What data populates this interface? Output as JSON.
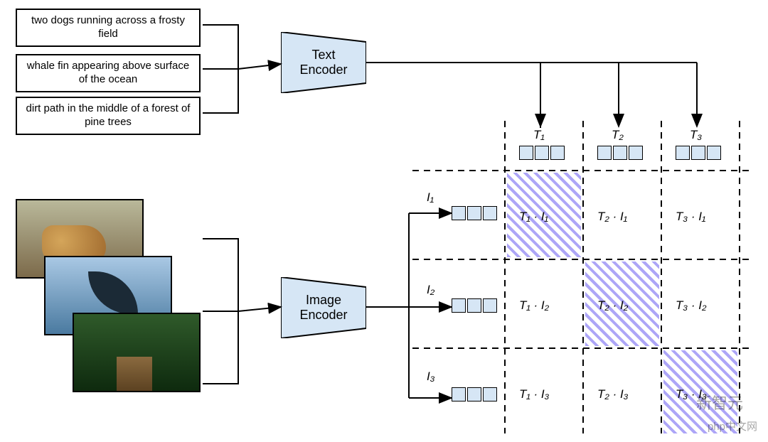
{
  "texts": {
    "t1": "two dogs running across a frosty field",
    "t2": "whale fin appearing above surface of the ocean",
    "t3": "dirt path in the middle of a forest of pine trees"
  },
  "encoders": {
    "text": "Text\nEncoder",
    "image": "Image\nEncoder"
  },
  "images": {
    "i1_desc": "two golden dogs running in a field",
    "i2_desc": "whale fin above ocean surface",
    "i3_desc": "dirt path through a pine forest"
  },
  "matrix": {
    "col_labels": [
      "T₁",
      "T₂",
      "T₃"
    ],
    "row_labels": [
      "I₁",
      "I₂",
      "I₃"
    ],
    "cells": [
      [
        "T₁ · I₁",
        "T₂ · I₁",
        "T₃ · I₁"
      ],
      [
        "T₁ · I₂",
        "T₂ · I₂",
        "T₃ · I₂"
      ],
      [
        "T₁ · I₃",
        "T₂ · I₃",
        "T₃ · I₃"
      ]
    ],
    "diag_highlight": true
  },
  "watermark": {
    "line1": "新智元",
    "line2": "php中文网"
  }
}
